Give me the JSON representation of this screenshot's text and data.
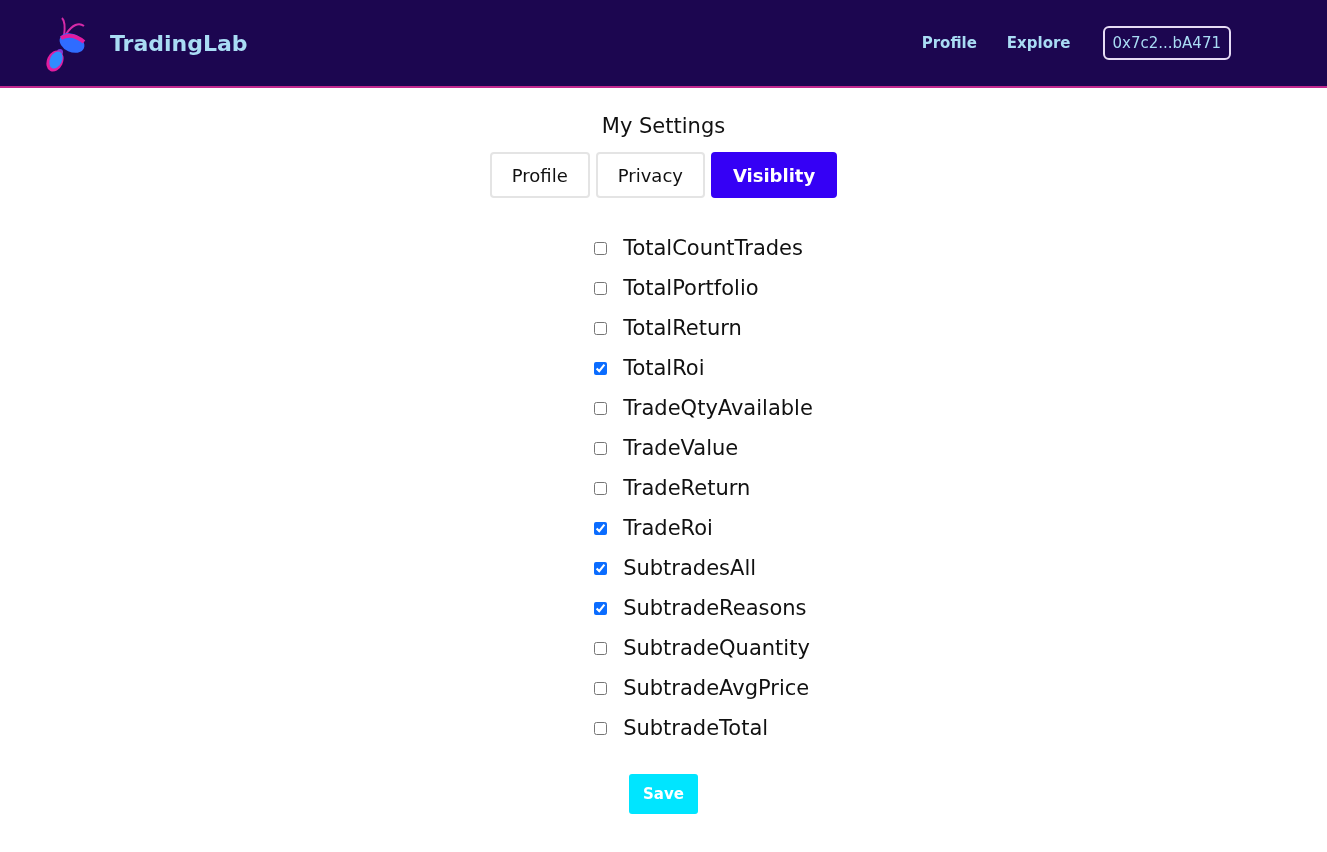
{
  "header": {
    "brand": "TradingLab",
    "nav": [
      "Profile",
      "Explore"
    ],
    "wallet": "0x7c2...bA471"
  },
  "page": {
    "title": "My Settings"
  },
  "tabs": [
    {
      "label": "Profile",
      "selected": false
    },
    {
      "label": "Privacy",
      "selected": false
    },
    {
      "label": "Visiblity",
      "selected": true
    }
  ],
  "options": [
    {
      "label": "TotalCountTrades",
      "checked": false
    },
    {
      "label": "TotalPortfolio",
      "checked": false
    },
    {
      "label": "TotalReturn",
      "checked": false
    },
    {
      "label": "TotalRoi",
      "checked": true
    },
    {
      "label": "TradeQtyAvailable",
      "checked": false
    },
    {
      "label": "TradeValue",
      "checked": false
    },
    {
      "label": "TradeReturn",
      "checked": false
    },
    {
      "label": "TradeRoi",
      "checked": true
    },
    {
      "label": "SubtradesAll",
      "checked": true
    },
    {
      "label": "SubtradeReasons",
      "checked": true
    },
    {
      "label": "SubtradeQuantity",
      "checked": false
    },
    {
      "label": "SubtradeAvgPrice",
      "checked": false
    },
    {
      "label": "SubtradeTotal",
      "checked": false
    }
  ],
  "save_button": "Save"
}
